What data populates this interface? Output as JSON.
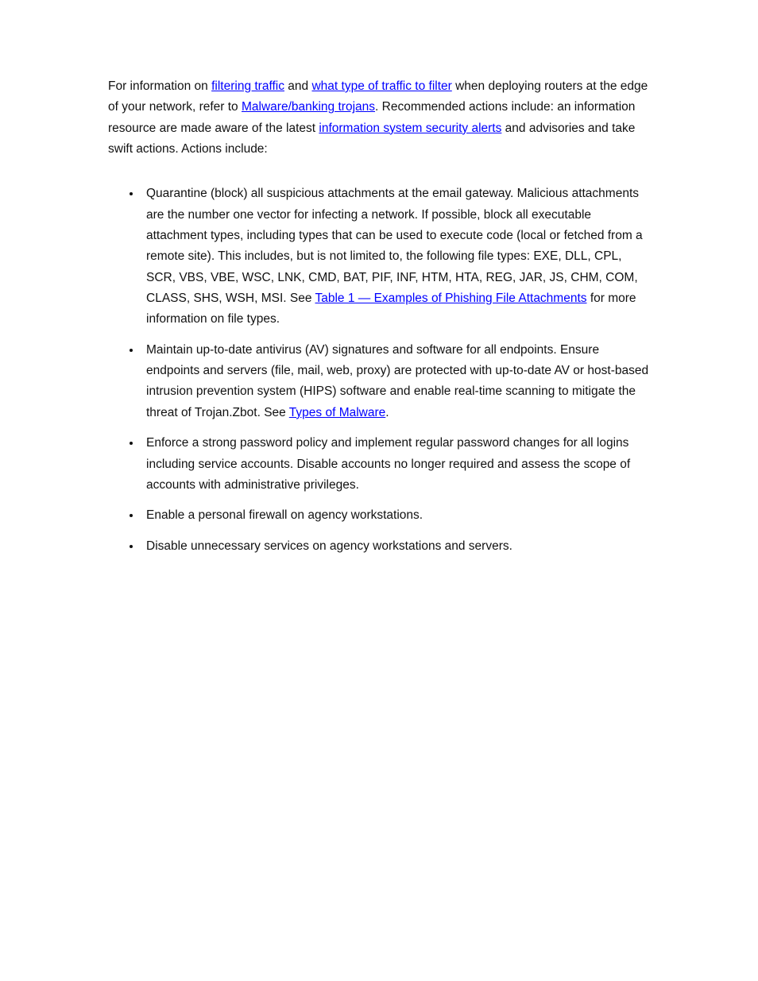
{
  "doc": {
    "intro": {
      "s1_pre": "For information on ",
      "s1_link1": "filtering traffic",
      "s1_mid": " and ",
      "s1_link2": "what type of traffic to filter",
      "s1_post": " when deploying routers at the edge of your network, refer to ",
      "s1_link3": "Malware/banking trojans",
      "s1_end": ". Recommended actions include:",
      "s2_pre": "an information resource are made aware of the latest ",
      "s2_link": "information system security alerts",
      "s2_post": " and advisories and take swift actions. Actions include:"
    },
    "items": [
      {
        "t0": "",
        "t1": "Quarantine (block) all suspicious attachments at the email gateway. Malicious attachments are the number one vector for infecting a network. If possible, block all executable attachment types, including types that can be used to execute code (local or fetched from a remote site). This includes, but is not limited to, the following file types: EXE, DLL, CPL, SCR, VBS, VBE, WSC, LNK, CMD, BAT, PIF, INF, HTM, HTA, REG, JAR, JS, CHM, COM, CLASS, SHS, WSH, MSI. See ",
        "link": "Table 1 — Examples of Phishing File Attachments",
        "t2": " for more information on file types."
      },
      {
        "t0": "",
        "t1": "Maintain up-to-date antivirus (AV) signatures and software for all endpoints. Ensure endpoints and servers (file, mail, web, proxy) are protected with up-to-date AV or host-based intrusion prevention system (HIPS) software and enable real-time scanning to mitigate the threat of Trojan.Zbot. See ",
        "link": "Types of Malware",
        "t2": "."
      },
      {
        "t0": "",
        "t1": "Enforce a strong password policy and implement regular password changes for all logins including service accounts. Disable accounts no longer required and assess the scope of accounts with administrative privileges.",
        "link": "",
        "t2": ""
      },
      {
        "t0": "",
        "t1": "Enable a personal firewall on agency workstations.",
        "link": "",
        "t2": ""
      },
      {
        "t0": "",
        "t1": "Disable unnecessary services on agency workstations and servers.",
        "link": "",
        "t2": ""
      }
    ]
  }
}
